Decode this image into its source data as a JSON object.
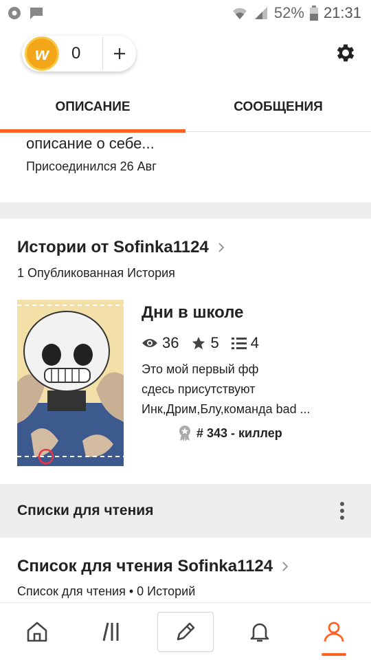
{
  "status_bar": {
    "battery": "52%",
    "time": "21:31"
  },
  "header": {
    "coin_count": "0",
    "coin_letter": "w",
    "add_label": "+"
  },
  "tabs": [
    {
      "label": "ОПИСАНИЕ",
      "active": true
    },
    {
      "label": "СООБЩЕНИЯ",
      "active": false
    }
  ],
  "about": {
    "description": "описание о себе...",
    "joined": "Присоединился 26 Авг"
  },
  "stories": {
    "title": "Истории от Sofinka1124",
    "subtitle": "1 Опубликованная История",
    "items": [
      {
        "title": "Дни в школе",
        "views": "36",
        "votes": "5",
        "parts": "4",
        "description_lines": [
          "Это мой первый фф",
          "сдесь присутствуют",
          "Инк,Дрим,Блу,команда bad ..."
        ],
        "rank": "# 343 - киллер"
      }
    ]
  },
  "reading_lists_bar": {
    "label": "Списки для чтения"
  },
  "reading_list": {
    "title": "Список для чтения Sofinka1124",
    "subtitle": "Список для чтения • 0 Историй"
  },
  "bottom_nav": [
    {
      "icon": "home-icon"
    },
    {
      "icon": "library-icon"
    },
    {
      "icon": "pencil-icon"
    },
    {
      "icon": "bell-icon"
    },
    {
      "icon": "profile-icon",
      "active": true
    }
  ],
  "colors": {
    "accent": "#ff6122",
    "coin": "#f2a516",
    "band": "#eeeeee"
  }
}
